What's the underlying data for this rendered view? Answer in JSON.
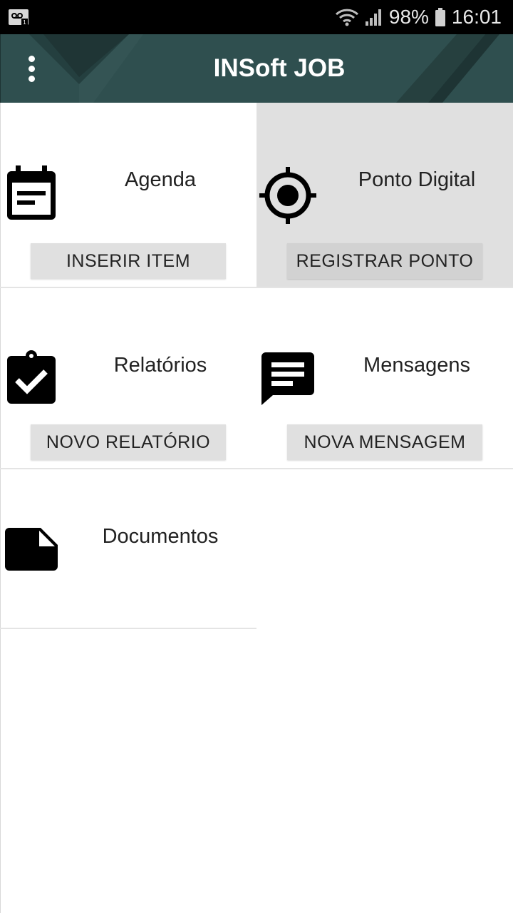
{
  "status_bar": {
    "battery_percent": "98%",
    "time": "16:01",
    "icons": [
      "voicemail-icon",
      "wifi-icon",
      "signal-icon",
      "battery-icon"
    ]
  },
  "app_bar": {
    "title": "INSoft JOB",
    "menu_icon": "more-vert-icon",
    "background_color": "#2f4f4f"
  },
  "tiles": [
    {
      "title": "Agenda",
      "button": "INSERIR ITEM",
      "icon": "calendar-icon",
      "selected": false
    },
    {
      "title": "Ponto Digital",
      "button": "REGISTRAR PONTO",
      "icon": "gps-target-icon",
      "selected": true
    },
    {
      "title": "Relatórios",
      "button": "NOVO RELATÓRIO",
      "icon": "clipboard-check-icon",
      "selected": false
    },
    {
      "title": "Mensagens",
      "button": "NOVA MENSAGEM",
      "icon": "message-icon",
      "selected": false
    },
    {
      "title": "Documentos",
      "icon": "document-icon",
      "selected": false
    }
  ],
  "colors": {
    "selected_tile_bg": "#e0e0e0",
    "button_bg": "#e0e0e0"
  }
}
